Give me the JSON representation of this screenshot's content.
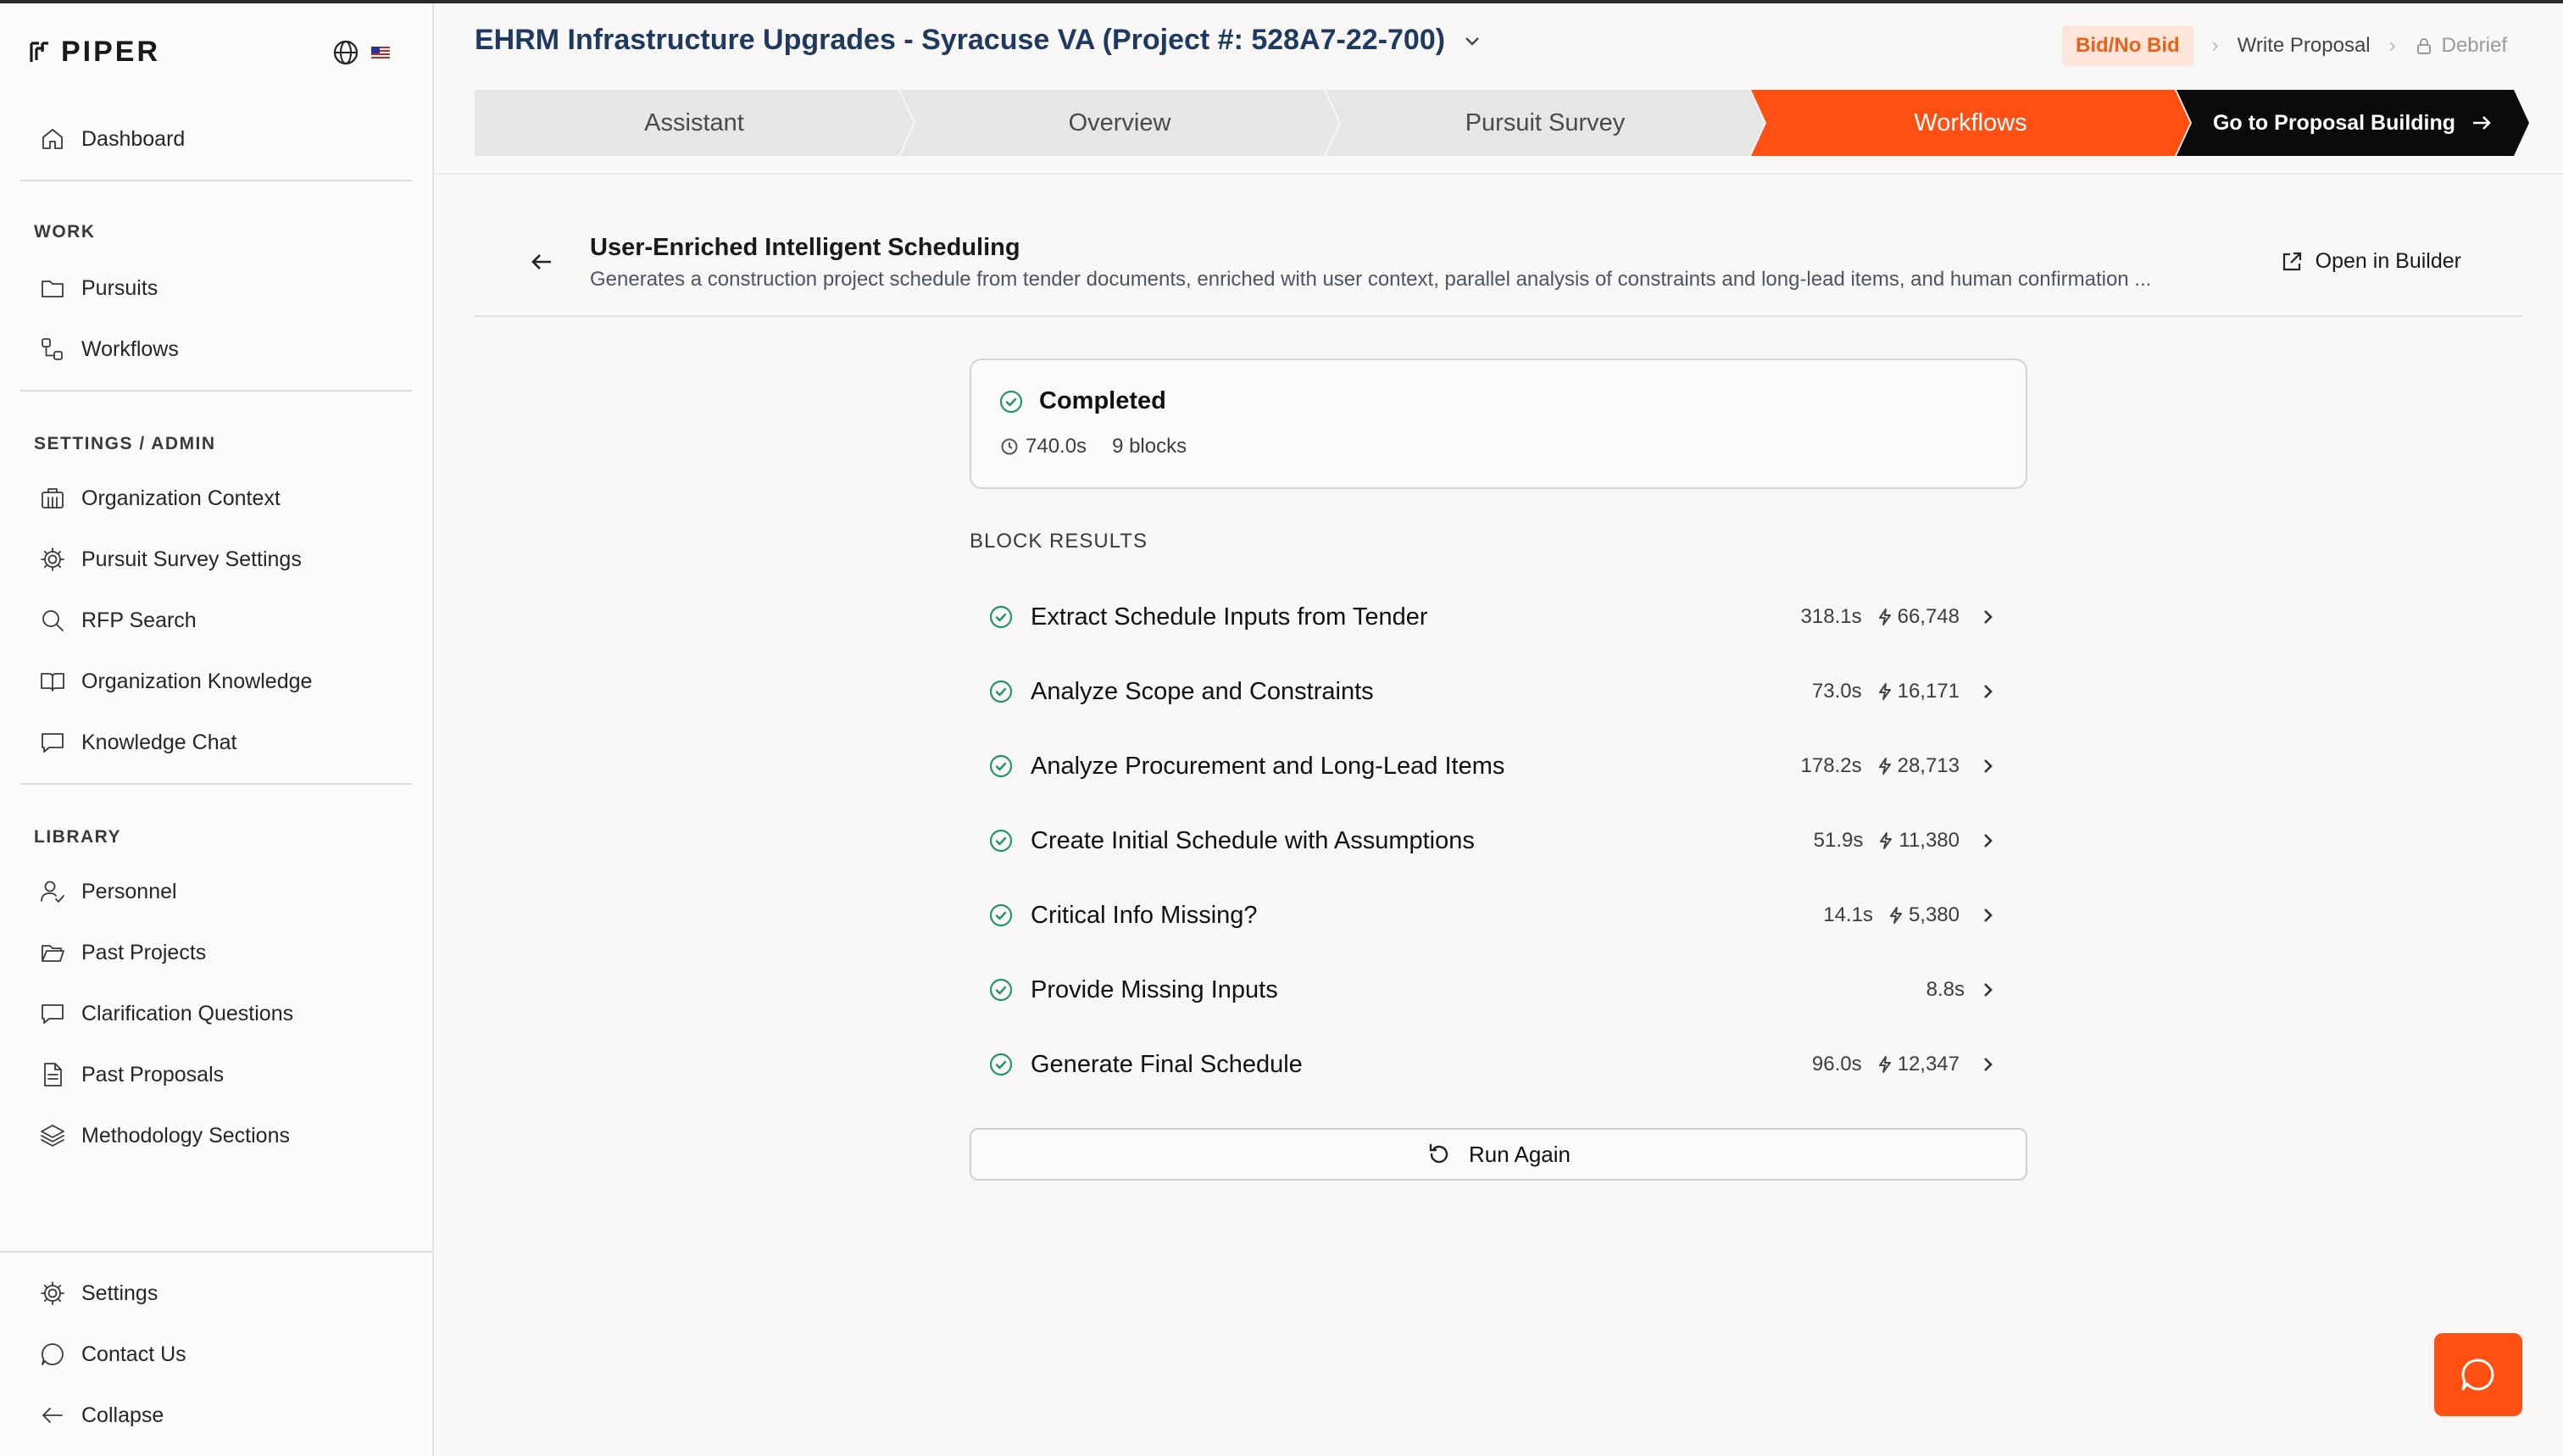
{
  "app": {
    "brand": "PIPER"
  },
  "sidebar": {
    "dashboard": "Dashboard",
    "work_label": "WORK",
    "work_items": [
      "Pursuits",
      "Workflows"
    ],
    "settings_label": "SETTINGS / ADMIN",
    "settings_items": [
      "Organization Context",
      "Pursuit Survey Settings",
      "RFP Search",
      "Organization Knowledge",
      "Knowledge Chat"
    ],
    "library_label": "LIBRARY",
    "library_items": [
      "Personnel",
      "Past Projects",
      "Clarification Questions",
      "Past Proposals",
      "Methodology Sections"
    ],
    "footer_items": [
      "Settings",
      "Contact Us",
      "Collapse"
    ]
  },
  "header": {
    "project_title": "EHRM Infrastructure Upgrades - Syracuse VA (Project #: 528A7-22-700)",
    "stages": {
      "bid": "Bid/No Bid",
      "write": "Write Proposal",
      "debrief": "Debrief"
    },
    "tabs": [
      "Assistant",
      "Overview",
      "Pursuit Survey",
      "Workflows"
    ],
    "cta": "Go to Proposal Building"
  },
  "workflow": {
    "title": "User-Enriched Intelligent Scheduling",
    "description": "Generates a construction project schedule from tender documents, enriched with user context, parallel analysis of constraints and long-lead items, and human confirmation ...",
    "open_builder": "Open in Builder",
    "status": "Completed",
    "duration": "740.0s",
    "block_count": "9 blocks",
    "block_results_label": "BLOCK RESULTS",
    "run_again": "Run Again"
  },
  "blocks": [
    {
      "name": "Extract Schedule Inputs from Tender",
      "time": "318.1s",
      "tokens": "66,748"
    },
    {
      "name": "Analyze Scope and Constraints",
      "time": "73.0s",
      "tokens": "16,171"
    },
    {
      "name": "Analyze Procurement and Long-Lead Items",
      "time": "178.2s",
      "tokens": "28,713"
    },
    {
      "name": "Create Initial Schedule with Assumptions",
      "time": "51.9s",
      "tokens": "11,380"
    },
    {
      "name": "Critical Info Missing?",
      "time": "14.1s",
      "tokens": "5,380"
    },
    {
      "name": "Provide Missing Inputs",
      "time": "8.8s",
      "tokens": ""
    },
    {
      "name": "Generate Final Schedule",
      "time": "96.0s",
      "tokens": "12,347"
    }
  ],
  "colors": {
    "accent": "#ff4f12",
    "success": "#22956b",
    "title": "#1e3a5f",
    "stage_badge_bg": "#fde6d9"
  }
}
